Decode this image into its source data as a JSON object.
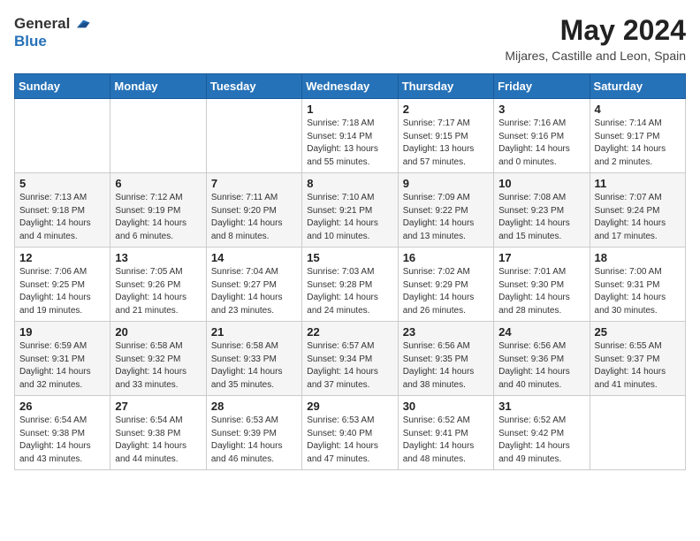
{
  "header": {
    "logo_general": "General",
    "logo_blue": "Blue",
    "title": "May 2024",
    "location": "Mijares, Castille and Leon, Spain"
  },
  "weekdays": [
    "Sunday",
    "Monday",
    "Tuesday",
    "Wednesday",
    "Thursday",
    "Friday",
    "Saturday"
  ],
  "weeks": [
    [
      {
        "day": "",
        "sunrise": "",
        "sunset": "",
        "daylight": ""
      },
      {
        "day": "",
        "sunrise": "",
        "sunset": "",
        "daylight": ""
      },
      {
        "day": "",
        "sunrise": "",
        "sunset": "",
        "daylight": ""
      },
      {
        "day": "1",
        "sunrise": "Sunrise: 7:18 AM",
        "sunset": "Sunset: 9:14 PM",
        "daylight": "Daylight: 13 hours and 55 minutes."
      },
      {
        "day": "2",
        "sunrise": "Sunrise: 7:17 AM",
        "sunset": "Sunset: 9:15 PM",
        "daylight": "Daylight: 13 hours and 57 minutes."
      },
      {
        "day": "3",
        "sunrise": "Sunrise: 7:16 AM",
        "sunset": "Sunset: 9:16 PM",
        "daylight": "Daylight: 14 hours and 0 minutes."
      },
      {
        "day": "4",
        "sunrise": "Sunrise: 7:14 AM",
        "sunset": "Sunset: 9:17 PM",
        "daylight": "Daylight: 14 hours and 2 minutes."
      }
    ],
    [
      {
        "day": "5",
        "sunrise": "Sunrise: 7:13 AM",
        "sunset": "Sunset: 9:18 PM",
        "daylight": "Daylight: 14 hours and 4 minutes."
      },
      {
        "day": "6",
        "sunrise": "Sunrise: 7:12 AM",
        "sunset": "Sunset: 9:19 PM",
        "daylight": "Daylight: 14 hours and 6 minutes."
      },
      {
        "day": "7",
        "sunrise": "Sunrise: 7:11 AM",
        "sunset": "Sunset: 9:20 PM",
        "daylight": "Daylight: 14 hours and 8 minutes."
      },
      {
        "day": "8",
        "sunrise": "Sunrise: 7:10 AM",
        "sunset": "Sunset: 9:21 PM",
        "daylight": "Daylight: 14 hours and 10 minutes."
      },
      {
        "day": "9",
        "sunrise": "Sunrise: 7:09 AM",
        "sunset": "Sunset: 9:22 PM",
        "daylight": "Daylight: 14 hours and 13 minutes."
      },
      {
        "day": "10",
        "sunrise": "Sunrise: 7:08 AM",
        "sunset": "Sunset: 9:23 PM",
        "daylight": "Daylight: 14 hours and 15 minutes."
      },
      {
        "day": "11",
        "sunrise": "Sunrise: 7:07 AM",
        "sunset": "Sunset: 9:24 PM",
        "daylight": "Daylight: 14 hours and 17 minutes."
      }
    ],
    [
      {
        "day": "12",
        "sunrise": "Sunrise: 7:06 AM",
        "sunset": "Sunset: 9:25 PM",
        "daylight": "Daylight: 14 hours and 19 minutes."
      },
      {
        "day": "13",
        "sunrise": "Sunrise: 7:05 AM",
        "sunset": "Sunset: 9:26 PM",
        "daylight": "Daylight: 14 hours and 21 minutes."
      },
      {
        "day": "14",
        "sunrise": "Sunrise: 7:04 AM",
        "sunset": "Sunset: 9:27 PM",
        "daylight": "Daylight: 14 hours and 23 minutes."
      },
      {
        "day": "15",
        "sunrise": "Sunrise: 7:03 AM",
        "sunset": "Sunset: 9:28 PM",
        "daylight": "Daylight: 14 hours and 24 minutes."
      },
      {
        "day": "16",
        "sunrise": "Sunrise: 7:02 AM",
        "sunset": "Sunset: 9:29 PM",
        "daylight": "Daylight: 14 hours and 26 minutes."
      },
      {
        "day": "17",
        "sunrise": "Sunrise: 7:01 AM",
        "sunset": "Sunset: 9:30 PM",
        "daylight": "Daylight: 14 hours and 28 minutes."
      },
      {
        "day": "18",
        "sunrise": "Sunrise: 7:00 AM",
        "sunset": "Sunset: 9:31 PM",
        "daylight": "Daylight: 14 hours and 30 minutes."
      }
    ],
    [
      {
        "day": "19",
        "sunrise": "Sunrise: 6:59 AM",
        "sunset": "Sunset: 9:31 PM",
        "daylight": "Daylight: 14 hours and 32 minutes."
      },
      {
        "day": "20",
        "sunrise": "Sunrise: 6:58 AM",
        "sunset": "Sunset: 9:32 PM",
        "daylight": "Daylight: 14 hours and 33 minutes."
      },
      {
        "day": "21",
        "sunrise": "Sunrise: 6:58 AM",
        "sunset": "Sunset: 9:33 PM",
        "daylight": "Daylight: 14 hours and 35 minutes."
      },
      {
        "day": "22",
        "sunrise": "Sunrise: 6:57 AM",
        "sunset": "Sunset: 9:34 PM",
        "daylight": "Daylight: 14 hours and 37 minutes."
      },
      {
        "day": "23",
        "sunrise": "Sunrise: 6:56 AM",
        "sunset": "Sunset: 9:35 PM",
        "daylight": "Daylight: 14 hours and 38 minutes."
      },
      {
        "day": "24",
        "sunrise": "Sunrise: 6:56 AM",
        "sunset": "Sunset: 9:36 PM",
        "daylight": "Daylight: 14 hours and 40 minutes."
      },
      {
        "day": "25",
        "sunrise": "Sunrise: 6:55 AM",
        "sunset": "Sunset: 9:37 PM",
        "daylight": "Daylight: 14 hours and 41 minutes."
      }
    ],
    [
      {
        "day": "26",
        "sunrise": "Sunrise: 6:54 AM",
        "sunset": "Sunset: 9:38 PM",
        "daylight": "Daylight: 14 hours and 43 minutes."
      },
      {
        "day": "27",
        "sunrise": "Sunrise: 6:54 AM",
        "sunset": "Sunset: 9:38 PM",
        "daylight": "Daylight: 14 hours and 44 minutes."
      },
      {
        "day": "28",
        "sunrise": "Sunrise: 6:53 AM",
        "sunset": "Sunset: 9:39 PM",
        "daylight": "Daylight: 14 hours and 46 minutes."
      },
      {
        "day": "29",
        "sunrise": "Sunrise: 6:53 AM",
        "sunset": "Sunset: 9:40 PM",
        "daylight": "Daylight: 14 hours and 47 minutes."
      },
      {
        "day": "30",
        "sunrise": "Sunrise: 6:52 AM",
        "sunset": "Sunset: 9:41 PM",
        "daylight": "Daylight: 14 hours and 48 minutes."
      },
      {
        "day": "31",
        "sunrise": "Sunrise: 6:52 AM",
        "sunset": "Sunset: 9:42 PM",
        "daylight": "Daylight: 14 hours and 49 minutes."
      },
      {
        "day": "",
        "sunrise": "",
        "sunset": "",
        "daylight": ""
      }
    ]
  ]
}
